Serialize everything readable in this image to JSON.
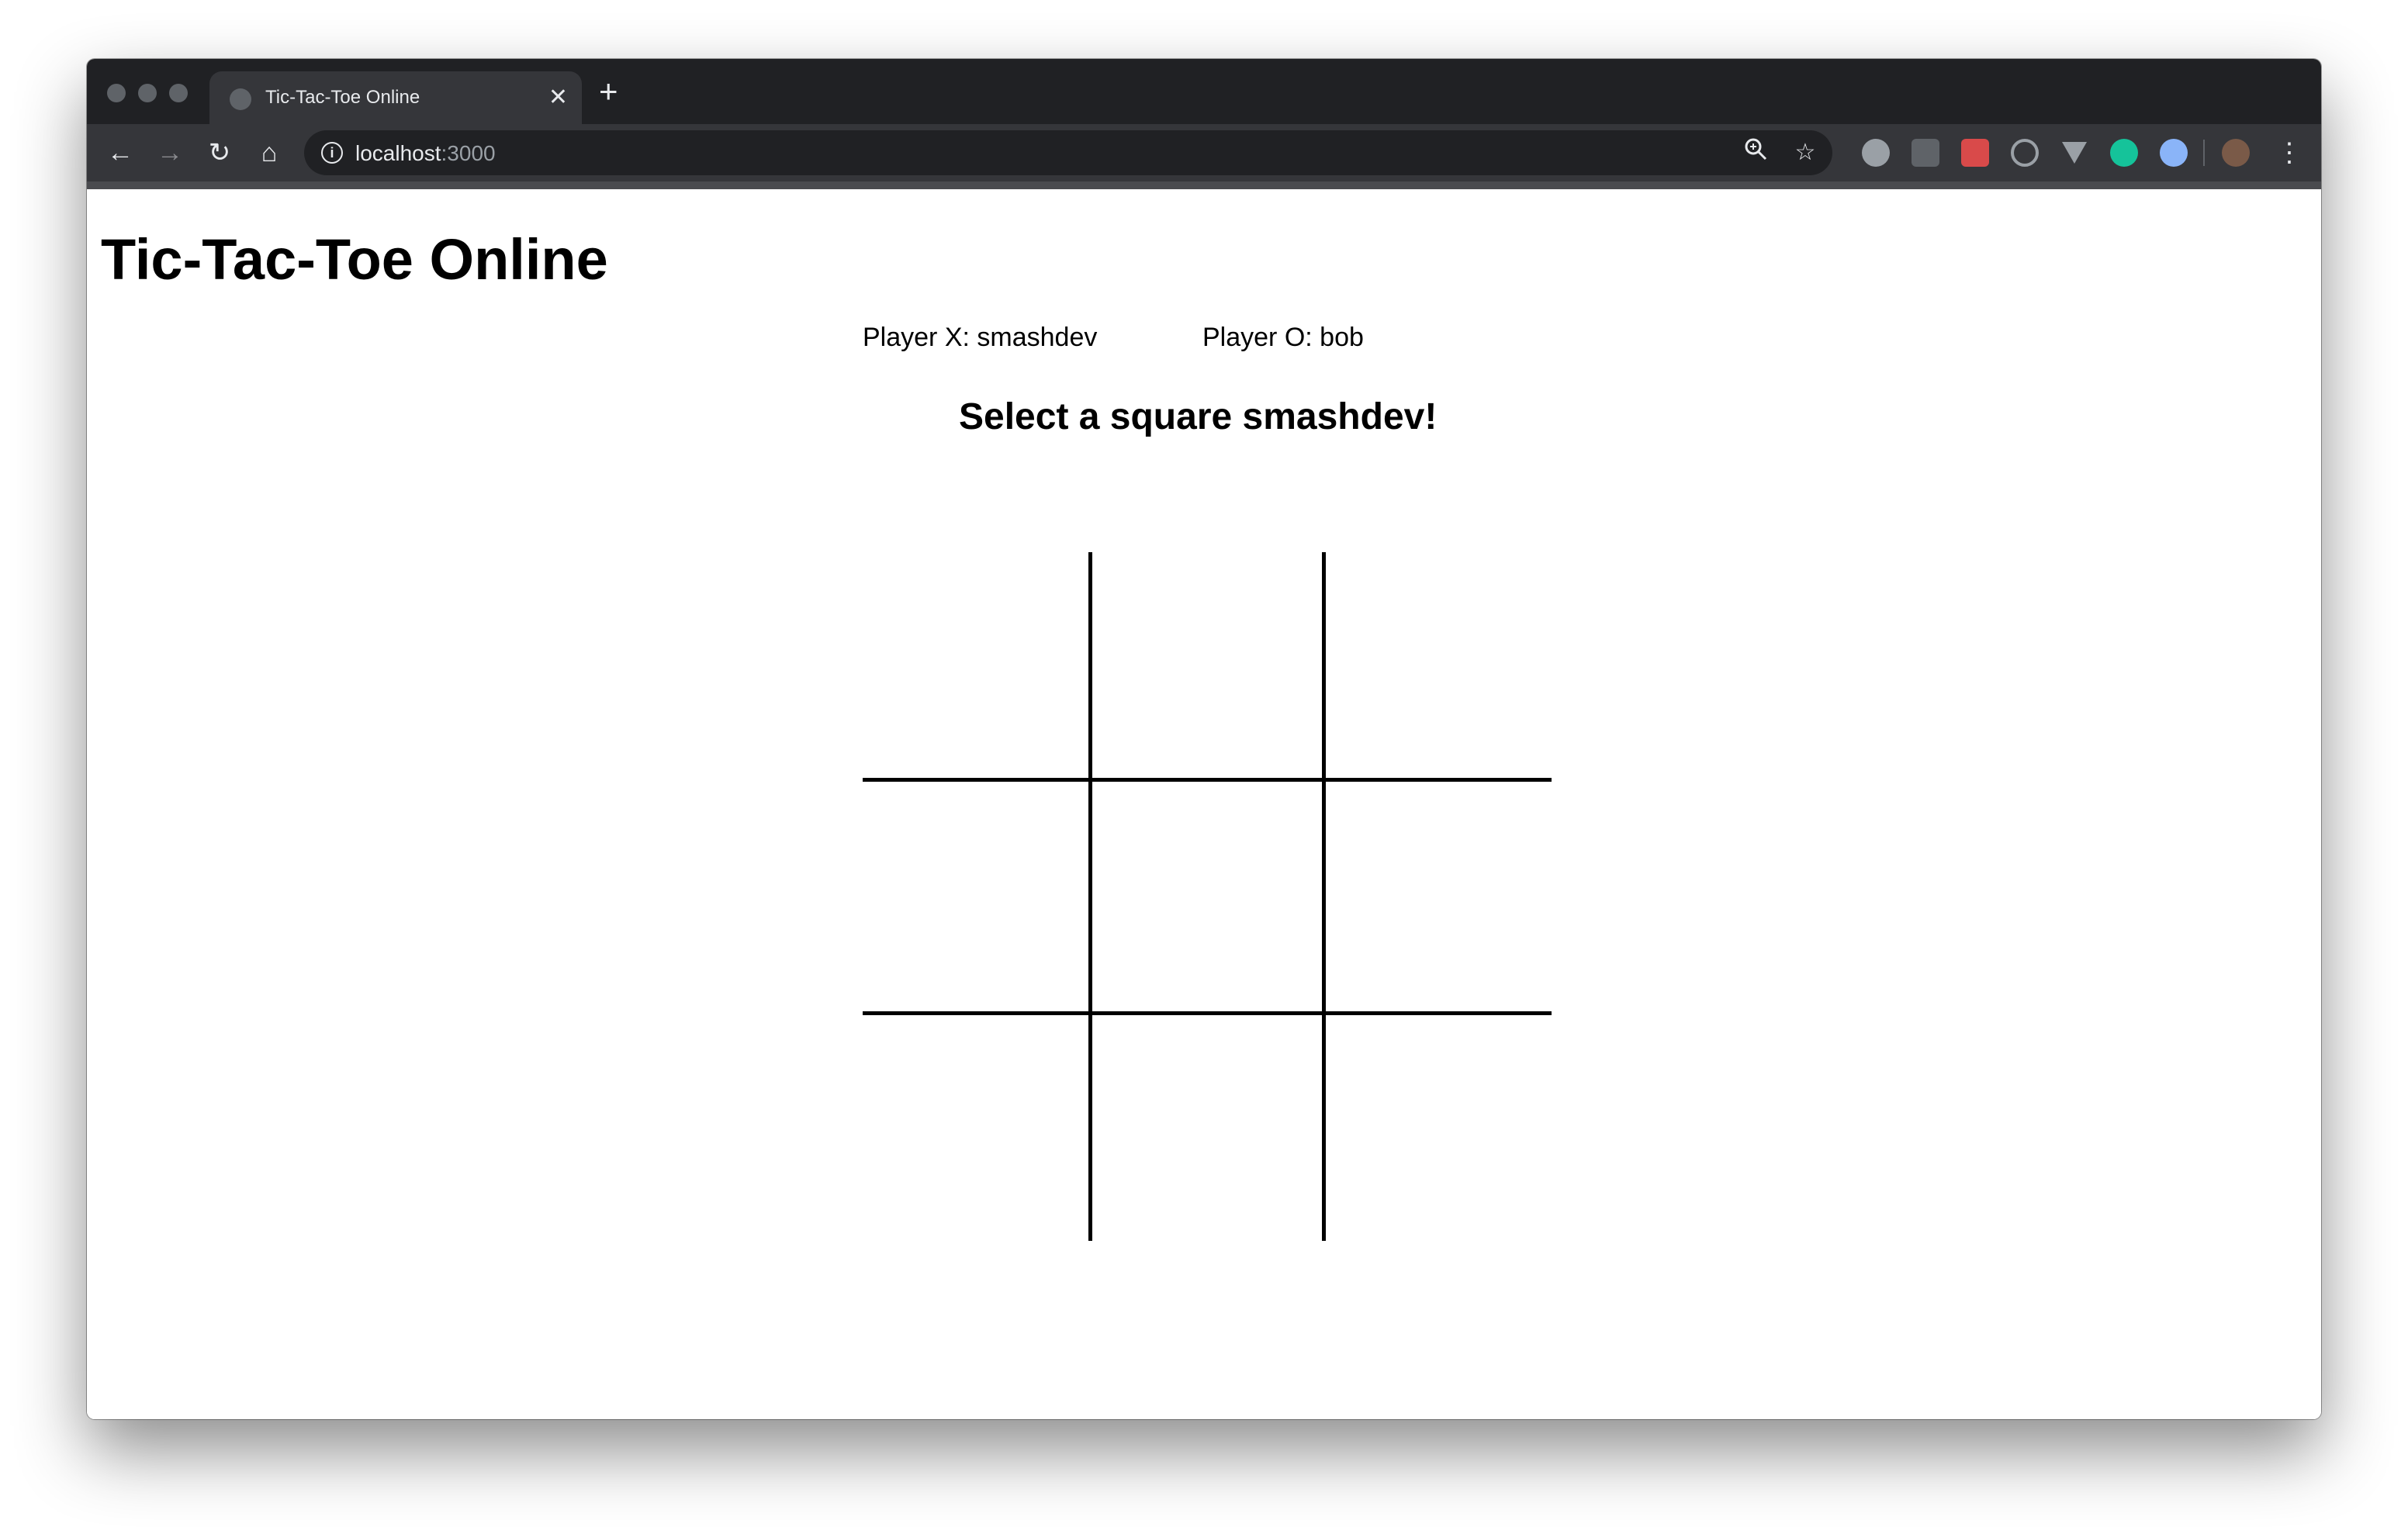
{
  "browser": {
    "tab_title": "Tic-Tac-Toe Online",
    "tab_close": "✕",
    "new_tab": "+",
    "url_host": "localhost",
    "url_port": ":3000",
    "nav": {
      "back": "←",
      "forward": "→",
      "reload": "↻",
      "home": "⌂"
    },
    "icons": {
      "zoom": "zoom-icon",
      "star": "star-icon",
      "menu": "kebab-menu-icon"
    },
    "extension_colors": [
      "#9aa0a6",
      "#5f6368",
      "#d94a4a",
      "#9aa0a6",
      "#9aa0a6",
      "#15c39a",
      "#8ab4f8"
    ]
  },
  "page": {
    "title": "Tic-Tac-Toe Online",
    "player_x": "Player X: smashdev",
    "player_o": "Player O: bob",
    "prompt": "Select a square smashdev!",
    "board": [
      "",
      "",
      "",
      "",
      "",
      "",
      "",
      "",
      ""
    ]
  }
}
